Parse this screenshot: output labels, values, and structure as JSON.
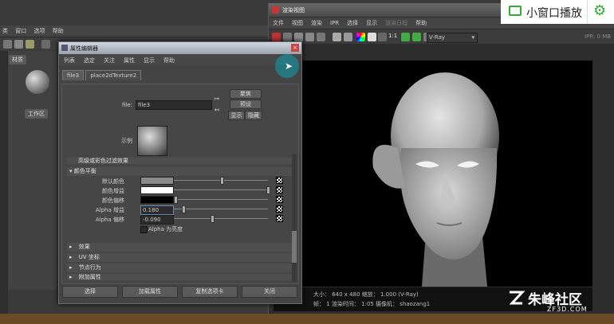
{
  "maya": {
    "menu": [
      "类",
      "窗口",
      "选项",
      "帮助"
    ],
    "hypershade_tabs": [
      "材质",
      "工作区"
    ]
  },
  "render_view": {
    "title": "渲染视图",
    "menu": [
      "文件",
      "视图",
      "渲染",
      "IPR",
      "选择",
      "显示",
      "渲染日程",
      "帮助"
    ],
    "ratio": "1:1",
    "renderer": "V-Ray",
    "ipr_label": "IPR: 0 MB",
    "status_line1": "大小： 640 x 480  缩放： 1.000     (V-Ray)",
    "status_line2": "帧： 1      渲染时间： 1:05          摄像机： shaozang1"
  },
  "attr_editor": {
    "title": "属性编辑器",
    "menu": [
      "列表",
      "选定",
      "关注",
      "属性",
      "显示",
      "帮助"
    ],
    "tabs": [
      "file3",
      "place2dTexture2"
    ],
    "file_label": "file:",
    "file_value": "file3",
    "btn_focus": "聚焦",
    "btn_preset": "预设",
    "btn_show": "显示",
    "btn_hide": "隐藏",
    "sample_label": "示例",
    "collapsed_header": "高级或彩色过滤效果",
    "section_color_balance": "颜色平衡",
    "rows": [
      {
        "label": "默认颜色"
      },
      {
        "label": "颜色增益"
      },
      {
        "label": "颜色偏移"
      },
      {
        "label": "Alpha 增益",
        "value": "0.180"
      },
      {
        "label": "Alpha 偏移",
        "value": "-0.090"
      }
    ],
    "alpha_is_luminance": "Alpha 为亮度",
    "sections": [
      "效果",
      "UV 坐标",
      "节点行为",
      "附加属性"
    ],
    "buttons": [
      "选择",
      "加载属性",
      "复制选项卡",
      "关闭"
    ]
  },
  "overlay": {
    "mini_window": "小窗口播放",
    "watermark_cn": "朱峰社区",
    "watermark_en": "ZF3D.COM"
  }
}
